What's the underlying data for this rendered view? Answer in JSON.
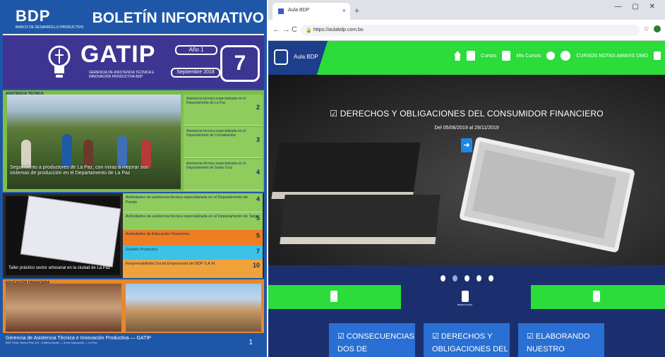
{
  "newsletter": {
    "logo": "BDP",
    "logo_sub": "BANCO DE DESARROLLO PRODUCTIVO",
    "title": "BOLETÍN INFORMATIVO",
    "brand": "GATIP",
    "brand_sub": "GERENCIA DE ASISTENCIA TÉCNICA E INNOVACIÓN PRODUCTIVA BDP",
    "year": "Año 1",
    "month": "Septiembre 2018",
    "issue": "7",
    "section1_label": "ASISTENCIA TÉCNICA",
    "photo1_caption": "Seguimiento a productores de La Paz, con miras a mejorar sus sistemas de producción en el Departamento de La Paz",
    "toc1": [
      {
        "text": "Asistencia técnica especializada en el Departamento de La Paz",
        "page": "2"
      },
      {
        "text": "Asistencia técnica especializada en el Departamento de Cochabamba",
        "page": "3"
      },
      {
        "text": "Asistencia técnica especializada en el Departamento de Santa Cruz",
        "page": "4"
      }
    ],
    "photo2_caption": "Taller práctico sector artesanal en la ciudad de La Paz",
    "photo2_page": "7",
    "toc2": [
      {
        "text": "Actividades de asistencia técnica especializada en el Departamento de Pando",
        "page": "4"
      },
      {
        "text": "Actividades de asistencia técnica especializada en el Departamento de Tarija",
        "page": "5"
      },
      {
        "text": "Actividades de Educación Financiera",
        "page": "5"
      },
      {
        "text": "Gestión Productos",
        "page": "7"
      },
      {
        "text": "Responsabilidad Social Empresarial del BDP S.A.M.",
        "page": "10"
      }
    ],
    "section3_label": "EDUCACIÓN FINANCIERA",
    "footer": "Gerencia de Asistencia Técnica e Innovación Productiva — GATIP",
    "footer_sub": "BDP SAM, Nueva Paz 222 - Edificio Alcalá — Zona Sopocachi — La Paz",
    "footer_page": "1"
  },
  "browser": {
    "tab_title": "Aula BDP",
    "url": "https://aulabdp.com.bo",
    "nav": {
      "back": "←",
      "forward": "→",
      "reload": "C"
    },
    "win_controls": "— ▢ ✕",
    "site_label": "Aula BDP",
    "menu": [
      {
        "label": "Cursos",
        "icon": "book-icon"
      },
      {
        "label": "Mis Cursos",
        "icon": "my-courses-icon"
      },
      {
        "label": "",
        "icon": "info-icon"
      },
      {
        "label": "CURSOS NOTAS AMAVIS OMO",
        "icon": "user-icon"
      }
    ],
    "hero_title": "☑ DERECHOS Y OBLIGACIONES DEL CONSUMIDOR FINANCIERO",
    "hero_date": "Del 05/06/2019 al 29/11/2019",
    "enter_glyph": "➜",
    "slide_count": 5,
    "active_slide": 1,
    "tabs": [
      {
        "label": "",
        "icon": "course-icon"
      },
      {
        "label": "BENEFICIARIO",
        "icon": "beneficiary-icon"
      },
      {
        "label": "",
        "icon": "drop-icon"
      }
    ],
    "cards": [
      {
        "title": "☑ CONSECUENCIAS",
        "subtitle": "DOS DE"
      },
      {
        "title": "☑ DERECHOS Y",
        "subtitle": "OBLIGACIONES DEL"
      },
      {
        "title": "☑ ELABORANDO",
        "subtitle": "NUESTRO"
      }
    ],
    "colors": {
      "green": "#2bdc3a",
      "navy": "#1b2f6e",
      "blue_card": "#2a6fd3"
    }
  }
}
